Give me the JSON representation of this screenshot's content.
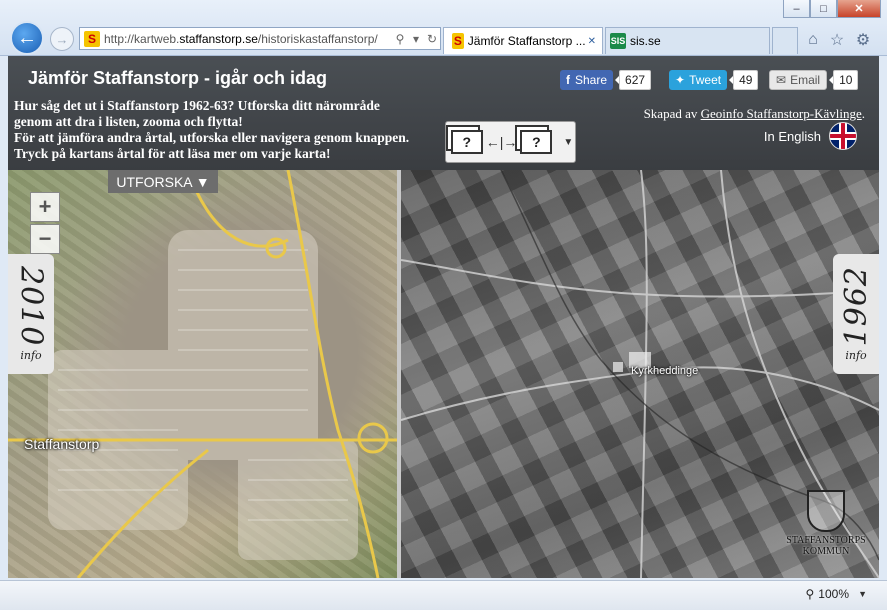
{
  "browser": {
    "address_url": "http://kartweb.staffanstorp.se/historiskastaffanstorp/",
    "address_url_prefix": "http://kartweb.",
    "address_url_domain": "staffanstorp.se",
    "address_url_path": "/historiskastaffanstorp/",
    "favicon_letter": "S",
    "tabs": [
      {
        "title": "Jämför Staffanstorp ...",
        "icon": "S"
      },
      {
        "title": "sis.se",
        "icon": "SIS"
      }
    ],
    "window_controls": {
      "minimize": "–",
      "maximize": "□",
      "close": "✕"
    },
    "zoom_level": "100%"
  },
  "header": {
    "title": "Jämför Staffanstorp - igår och idag",
    "intro_lines": [
      "Hur såg det ut i Staffanstorp 1962-63? Utforska ditt närområde",
      "genom att dra i listen, zooma och flytta!",
      "För att jämföra andra årtal, utforska eller navigera genom knappen.",
      "Tryck på kartans årtal för att läsa mer om varje karta!"
    ],
    "share": {
      "label": "Share",
      "count": "627"
    },
    "tweet": {
      "label": "Tweet",
      "count": "49"
    },
    "email": {
      "label": "Email",
      "count": "10"
    },
    "credit_prefix": "Skapad av ",
    "credit_link": "Geoinfo Staffanstorp-Kävlinge",
    "credit_suffix": ".",
    "english_label": "In English",
    "compare_q": "?"
  },
  "map_left": {
    "explore_label": "UTFORSKA ▼",
    "zoom_in": "+",
    "zoom_out": "−",
    "year": "2010",
    "info": "info",
    "place_label": "Staffanstorp"
  },
  "map_right": {
    "year": "1962",
    "info": "info",
    "place_label": "Kyrkheddinge",
    "logo_line1": "STAFFANSTORPS",
    "logo_line2": "KOMMUN"
  }
}
